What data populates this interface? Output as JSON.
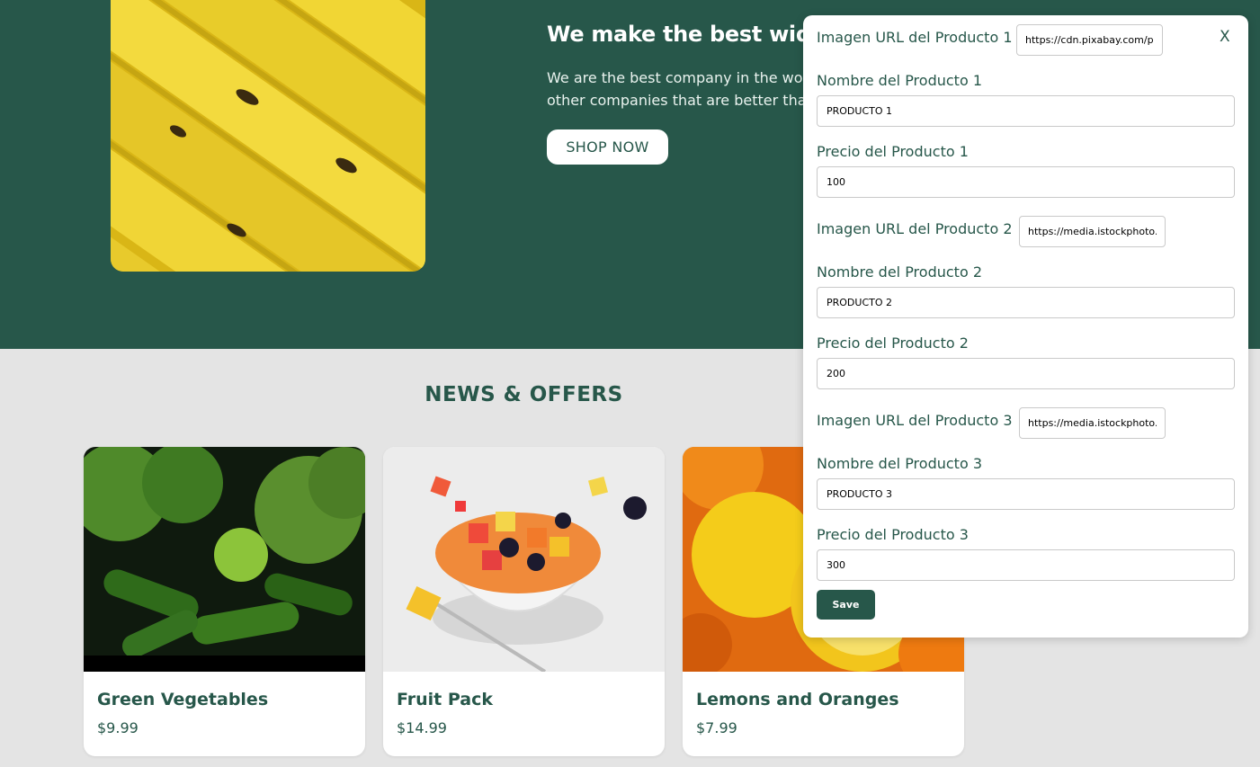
{
  "hero": {
    "title": "We make the best widg",
    "text_line1": "We are the best company in the wor",
    "text_line2": "other companies that are better tha",
    "cta_label": "SHOP NOW"
  },
  "news": {
    "title": "NEWS & OFFERS",
    "cards": [
      {
        "name": "Green Vegetables",
        "price": "$9.99"
      },
      {
        "name": "Fruit Pack",
        "price": "$14.99"
      },
      {
        "name": "Lemons and Oranges",
        "price": "$7.99"
      }
    ]
  },
  "modal": {
    "close_label": "X",
    "products": [
      {
        "image_label": "Imagen URL del Producto 1",
        "image_value": "https://cdn.pixabay.com/ph",
        "name_label": "Nombre del Producto 1",
        "name_value": "PRODUCTO 1",
        "price_label": "Precio del Producto 1",
        "price_value": "100"
      },
      {
        "image_label": "Imagen URL del Producto 2",
        "image_value": "https://media.istockphoto.c",
        "name_label": "Nombre del Producto 2",
        "name_value": "PRODUCTO 2",
        "price_label": "Precio del Producto 2",
        "price_value": "200"
      },
      {
        "image_label": "Imagen URL del Producto 3",
        "image_value": "https://media.istockphoto.c",
        "name_label": "Nombre del Producto 3",
        "name_value": "PRODUCTO 3",
        "price_label": "Precio del Producto 3",
        "price_value": "300"
      }
    ],
    "save_label": "Save"
  },
  "colors": {
    "brand_green": "#27574a",
    "page_background": "#e4e4e4"
  }
}
